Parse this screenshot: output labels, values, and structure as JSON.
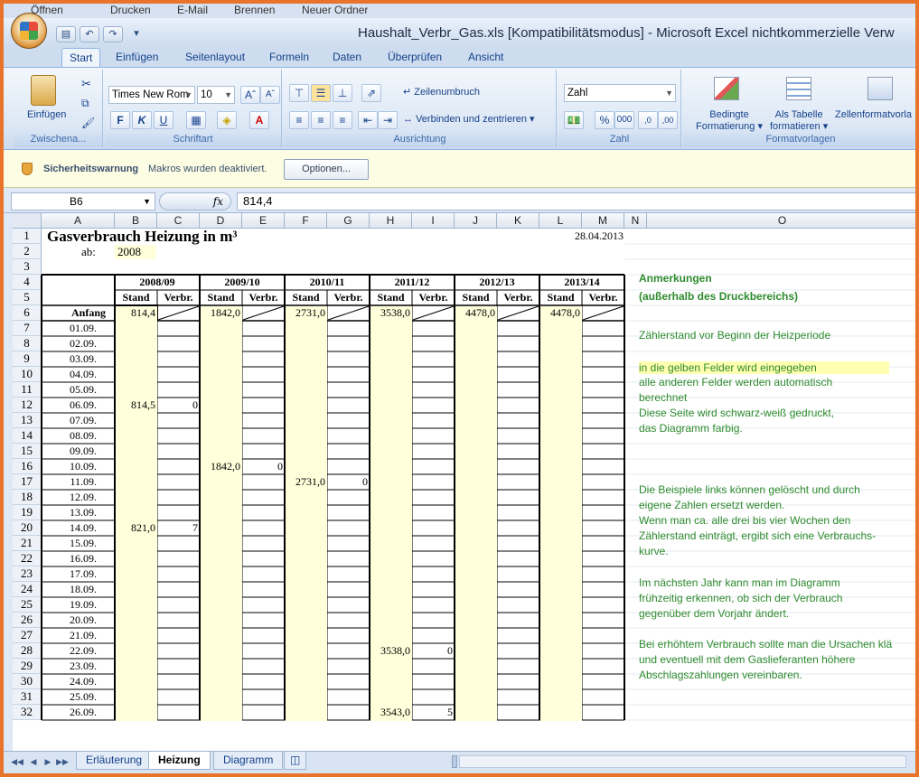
{
  "top_strip": {
    "items": [
      "Öffnen",
      "Drucken",
      "E-Mail",
      "Brennen",
      "Neuer Ordner"
    ]
  },
  "title_bar": {
    "title": "Haushalt_Verbr_Gas.xls  [Kompatibilitätsmodus] - Microsoft Excel nichtkommerzielle Verw"
  },
  "ribbon_tabs": [
    "Start",
    "Einfügen",
    "Seitenlayout",
    "Formeln",
    "Daten",
    "Überprüfen",
    "Ansicht"
  ],
  "ribbon": {
    "clipboard": {
      "paste": "Einfügen",
      "label": "Zwischena..."
    },
    "font": {
      "name": "Times New Rom",
      "size": "10",
      "bold": "F",
      "italic": "K",
      "underline": "U",
      "label": "Schriftart"
    },
    "alignment": {
      "wrap": "Zeilenumbruch",
      "merge": "Verbinden und zentrieren",
      "label": "Ausrichtung"
    },
    "number": {
      "format": "Zahl",
      "label": "Zahl"
    },
    "styles": {
      "conditional": "Bedingte",
      "conditional2": "Formatierung",
      "astable": "Als Tabelle",
      "astable2": "formatieren",
      "cellstyles": "Zellenformatvorla",
      "label": "Formatvorlagen"
    }
  },
  "message_bar": {
    "title": "Sicherheitswarnung",
    "text": "Makros wurden deaktiviert.",
    "button": "Optionen..."
  },
  "formula_bar": {
    "name_box": "B6",
    "fx": "fx",
    "value": "814,4"
  },
  "columns": [
    "A",
    "B",
    "C",
    "D",
    "E",
    "F",
    "G",
    "H",
    "I",
    "J",
    "K",
    "L",
    "M",
    "N",
    "O"
  ],
  "sheet": {
    "title": "Gasverbrauch Heizung in m³",
    "date": "28.04.2013",
    "ab_label": "ab:",
    "ab_value": "2008",
    "years": [
      "2008/09",
      "2009/10",
      "2010/11",
      "2011/12",
      "2012/13",
      "2013/14"
    ],
    "stand": "Stand",
    "verbr": "Verbr.",
    "start_label": "Anfang",
    "start_values": [
      "814,4",
      "1842,0",
      "2731,0",
      "3538,0",
      "4478,0",
      "4478,0"
    ],
    "row_numbers": [
      "1",
      "2",
      "3",
      "4",
      "5",
      "6",
      "7",
      "8",
      "9",
      "10",
      "11",
      "12",
      "13",
      "14",
      "15",
      "16",
      "17",
      "18",
      "19",
      "20",
      "21",
      "22",
      "23",
      "24",
      "25",
      "26",
      "27",
      "28",
      "29",
      "30",
      "31",
      "32"
    ],
    "dates": [
      "01.09.",
      "02.09.",
      "03.09.",
      "04.09.",
      "05.09.",
      "06.09.",
      "07.09.",
      "08.09.",
      "09.09.",
      "10.09.",
      "11.09.",
      "12.09.",
      "13.09.",
      "14.09.",
      "15.09.",
      "16.09.",
      "17.09.",
      "18.09.",
      "19.09.",
      "20.09.",
      "21.09.",
      "22.09.",
      "23.09.",
      "24.09.",
      "25.09.",
      "26.09."
    ],
    "entries": [
      {
        "row": 12,
        "stand": "814,5",
        "verbr": "0",
        "year": 0
      },
      {
        "row": 16,
        "stand": "1842,0",
        "verbr": "0",
        "year": 1
      },
      {
        "row": 17,
        "stand": "2731,0",
        "verbr": "0",
        "year": 2
      },
      {
        "row": 20,
        "stand": "821,0",
        "verbr": "7",
        "year": 0
      },
      {
        "row": 28,
        "stand": "3538,0",
        "verbr": "0",
        "year": 3
      },
      {
        "row": 32,
        "stand": "3543,0",
        "verbr": "5",
        "year": 3
      }
    ],
    "notes": [
      {
        "text": "Anmerkungen",
        "bold": true,
        "hl": false
      },
      {
        "text": "(außerhalb des Druckbereichs)",
        "bold": true,
        "hl": false
      },
      {
        "text": "Zählerstand vor Beginn der Heizperiode",
        "bold": false,
        "hl": false
      },
      {
        "text": "in die gelben Felder wird eingegeben",
        "bold": false,
        "hl": true
      },
      {
        "text": "alle anderen Felder werden automatisch",
        "bold": false,
        "hl": false
      },
      {
        "text": "berechnet",
        "bold": false,
        "hl": false
      },
      {
        "text": "Diese Seite wird schwarz-weiß gedruckt,",
        "bold": false,
        "hl": false
      },
      {
        "text": "das Diagramm farbig.",
        "bold": false,
        "hl": false
      },
      {
        "text": "Die Beispiele links können gelöscht und durch",
        "bold": false,
        "hl": false
      },
      {
        "text": "eigene Zahlen ersetzt werden.",
        "bold": false,
        "hl": false
      },
      {
        "text": "Wenn man ca. alle drei bis vier Wochen den",
        "bold": false,
        "hl": false
      },
      {
        "text": "Zählerstand einträgt, ergibt sich eine Verbrauchs-",
        "bold": false,
        "hl": false
      },
      {
        "text": "kurve.",
        "bold": false,
        "hl": false
      },
      {
        "text": "Im nächsten Jahr kann man im Diagramm",
        "bold": false,
        "hl": false
      },
      {
        "text": "frühzeitig erkennen, ob sich der Verbrauch",
        "bold": false,
        "hl": false
      },
      {
        "text": "gegenüber dem Vorjahr ändert.",
        "bold": false,
        "hl": false
      },
      {
        "text": "Bei erhöhtem Verbrauch sollte man die Ursachen klä",
        "bold": false,
        "hl": false
      },
      {
        "text": "und eventuell mit dem Gaslieferanten höhere",
        "bold": false,
        "hl": false
      },
      {
        "text": "Abschlagszahlungen vereinbaren.",
        "bold": false,
        "hl": false
      }
    ]
  },
  "sheet_tabs": [
    "Erläuterung",
    "Heizung",
    "Diagramm"
  ],
  "active_sheet_tab": "Heizung",
  "colors": {
    "input_fill": "#ffffdc",
    "note_green": "#2e8b2e",
    "highlight": "#ffffb0",
    "frame": "#e8732a"
  }
}
